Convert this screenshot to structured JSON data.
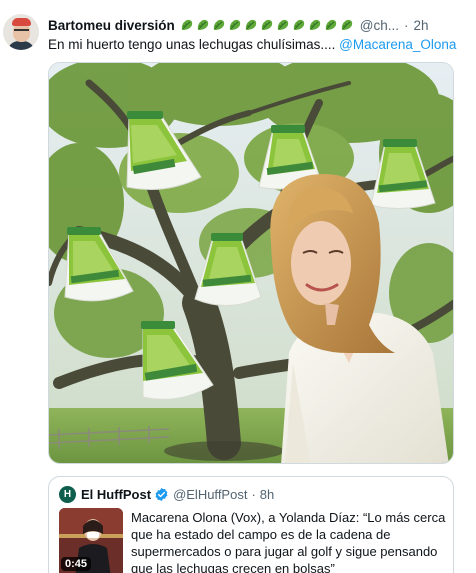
{
  "tweet": {
    "author_name": "Bartomeu diversión",
    "emoji_icon": "leafy-green-emoji",
    "emoji_count": 11,
    "handle": "@ch...",
    "separator": "·",
    "time": "2h",
    "text_prefix": "En mi huerto tengo unas lechugas chulísimas.... ",
    "mention": "@Macarena_Olona"
  },
  "media": {
    "description": "photo-collage-tree-lettuce-bags",
    "sky_color": "#dfe8ee",
    "foliage_color": "#6f9a3e",
    "trunk_color": "#4a4a38",
    "lettuce_color": "#8cc43c"
  },
  "quote": {
    "logo_text": "H",
    "author_name": "El HuffPost",
    "handle": "@ElHuffPost",
    "separator": "·",
    "time": "8h",
    "text": "Macarena Olona (Vox), a Yolanda Díaz: “Lo más cerca que ha estado del campo es de la cadena de supermercados o para jugar al golf y sigue pensando que las lechugas crecen en bolsas”",
    "video_duration": "0:45"
  },
  "colors": {
    "link": "#1d9bf0",
    "secondary_text": "#536471",
    "primary_text": "#0f1419",
    "border": "#cfd9de"
  }
}
